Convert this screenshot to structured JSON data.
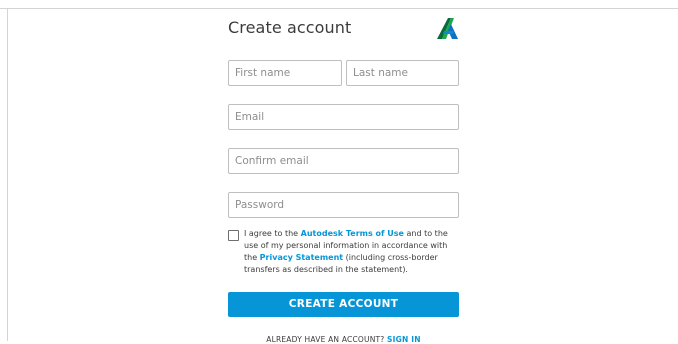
{
  "header": {
    "title": "Create account",
    "logo_icon": "autodesk-logo-icon"
  },
  "form": {
    "first_name_placeholder": "First name",
    "last_name_placeholder": "Last name",
    "email_placeholder": "Email",
    "confirm_email_placeholder": "Confirm email",
    "password_placeholder": "Password",
    "first_name_value": "",
    "last_name_value": "",
    "email_value": "",
    "confirm_email_value": "",
    "password_value": ""
  },
  "agreement": {
    "checked": false,
    "text_1": "I agree to the ",
    "terms_link": "Autodesk Terms of Use",
    "text_2": " and to the use of my personal information in accordance with the ",
    "privacy_link": "Privacy Statement",
    "text_3": " (including cross-border transfers as described in the statement)."
  },
  "actions": {
    "create_label": "CREATE ACCOUNT",
    "already_text": "ALREADY HAVE AN ACCOUNT? ",
    "sign_in_link": "SIGN IN"
  },
  "colors": {
    "accent": "#0696d7",
    "text": "#3c3c3c",
    "border": "#bfbfbf"
  }
}
